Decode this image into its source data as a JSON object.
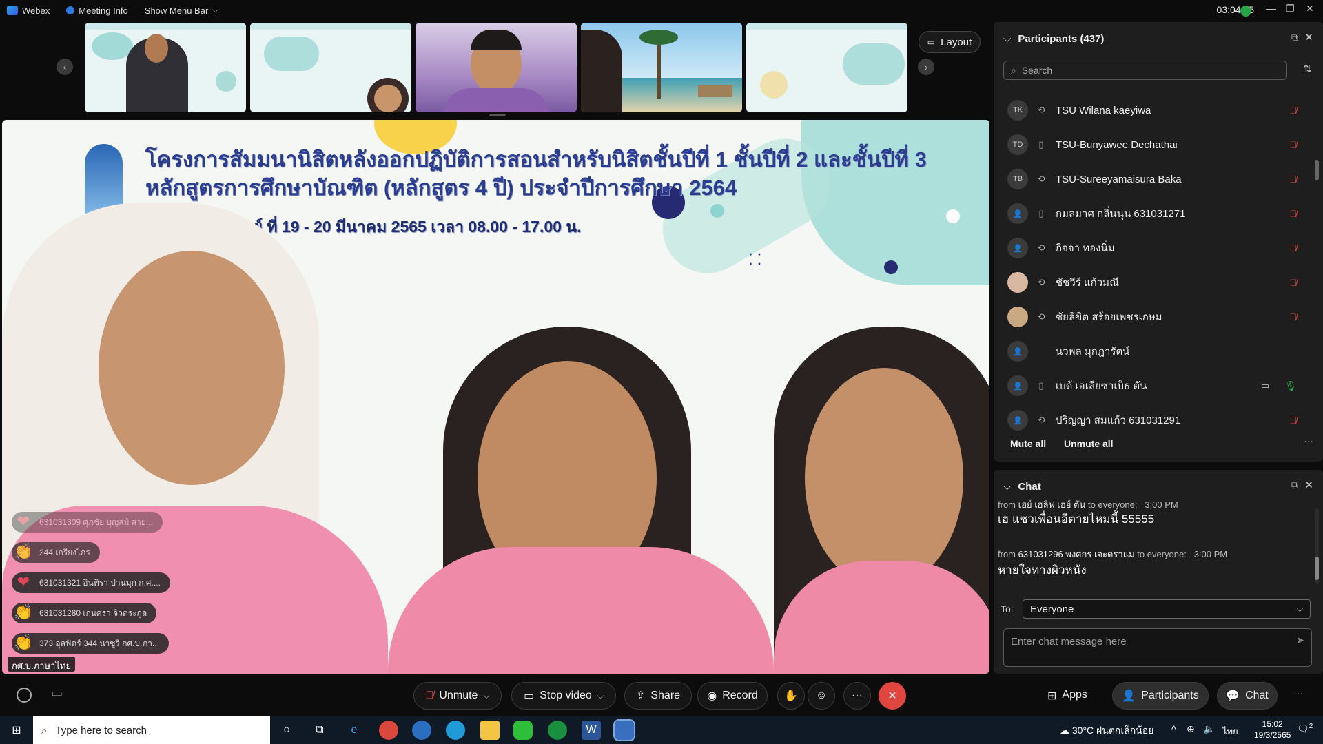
{
  "topbar": {
    "app_name": "Webex",
    "meeting_info": "Meeting Info",
    "show_menu_bar": "Show Menu Bar",
    "time": "03:04:35"
  },
  "filmstrip": {
    "layout_label": "Layout"
  },
  "main": {
    "slide_title_1": "โครงการสัมมนานิสิตหลังออกปฏิบัติการสอนสำหรับนิสิตชั้นปีที่ 1  ชั้นปีที่ 2 และชั้นปีที่ 3",
    "slide_title_2": "หลักสูตรการศึกษาบัณฑิต (หลักสูตร 4 ปี) ประจำปีการศึกษา  2564",
    "slide_title_3": "- วันอาทิตย์ ที่ 19 - 20 มีนาคม 2565 เวลา 08.00 - 17.00 น.",
    "name_label": "กศ.บ.ภาษาไทย",
    "reactions": [
      {
        "emoji": "❤",
        "text": "631031309 ศุภชัย บุญสมิ สาย..."
      },
      {
        "emoji": "👏",
        "text": "244 เกรียงไกร"
      },
      {
        "emoji": "❤",
        "text": "631031321 อินทิรา ปานมุก ก.ศ...."
      },
      {
        "emoji": "👏",
        "text": "631031280 เกนศรา จิวตระกูล"
      },
      {
        "emoji": "👏",
        "text": "373 อุลฟัตร์ 344 นาซูรี กศ.บ.ภา..."
      }
    ]
  },
  "participants": {
    "title": "Participants (437)",
    "search_placeholder": "Search",
    "list": [
      {
        "initials": "TK",
        "name": "TSU Wilana kaeyiwa",
        "device": "⟲"
      },
      {
        "initials": "TD",
        "name": "TSU-Bunyawee Dechathai",
        "device": "▯"
      },
      {
        "initials": "TB",
        "name": "TSU-Sureeyamaisura Baka",
        "device": "⟲"
      },
      {
        "initials": "",
        "name": "กมลมาศ กลิ่นนุ่น 631031271",
        "device": "▯"
      },
      {
        "initials": "",
        "name": "กิจจา ทองนิ่ม",
        "device": "⟲"
      },
      {
        "initials": "",
        "name": "ชัชวีร์ แก้วมณี",
        "device": "⟲"
      },
      {
        "initials": "",
        "name": "ชัยลิขิต สร้อยเพชรเกษม",
        "device": "⟲"
      },
      {
        "initials": "",
        "name": "นวพล มุกฎารัตน์",
        "device": ""
      },
      {
        "initials": "",
        "name": "เบด้ เอเลียซาเบ็ธ ตัน",
        "device": "▯"
      },
      {
        "initials": "",
        "name": "ปริญญา สมแก้ว 631031291",
        "device": "⟲"
      }
    ],
    "mute_all": "Mute all",
    "unmute_all": "Unmute all"
  },
  "chat": {
    "title": "Chat",
    "messages": [
      {
        "meta_from": "from",
        "sender": "เฮย์ เฮลิฟ เฮย์ ตัน",
        "meta_to": "to everyone:",
        "time": "3:00 PM",
        "text": "เฮ แซวเพื่อนอีตายไหมนี้ 55555"
      },
      {
        "meta_from": "from",
        "sender": "631031296 พงศกร เจะดราแม",
        "meta_to": "to everyone:",
        "time": "3:00 PM",
        "text": "หายใจทางผิวหนัง"
      }
    ],
    "to_label": "To:",
    "to_value": "Everyone",
    "input_placeholder": "Enter chat message here"
  },
  "controls": {
    "unmute": "Unmute",
    "stop_video": "Stop video",
    "share": "Share",
    "record": "Record",
    "apps": "Apps",
    "participants": "Participants",
    "chat": "Chat"
  },
  "taskbar": {
    "search_placeholder": "Type here to search",
    "weather": "30°C  ฝนตกเล็กน้อย",
    "lang": "ไทย",
    "time": "15:02",
    "date": "19/3/2565",
    "notif_count": "2"
  },
  "colors": {
    "accent_red": "#e0453f",
    "panel_bg": "#1e1e1e",
    "mic_green": "#37b24d"
  }
}
